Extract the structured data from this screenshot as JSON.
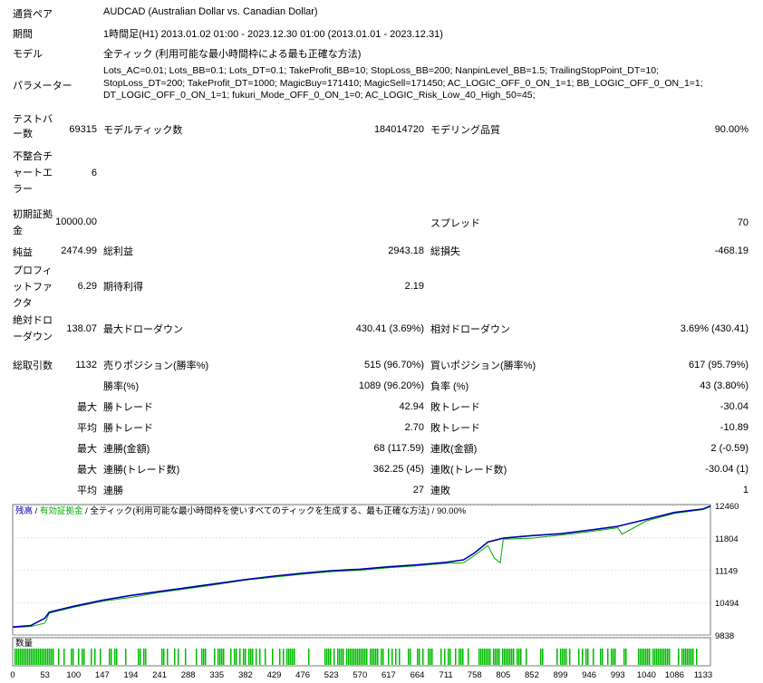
{
  "header": {
    "currency_pair_label": "通貨ペア",
    "currency_pair_value": "AUDCAD (Australian Dollar vs. Canadian Dollar)",
    "period_label": "期間",
    "period_value": "1時間足(H1) 2013.01.02 01:00 - 2023.12.30 01:00 (2013.01.01 - 2023.12.31)",
    "model_label": "モデル",
    "model_value": "全ティック (利用可能な最小時間枠による最も正確な方法)",
    "parameters_label": "パラメーター",
    "parameters_value": "Lots_AC=0.01; Lots_BB=0.1; Lots_DT=0.1; TakeProfit_BB=10; StopLoss_BB=200; NanpinLevel_BB=1.5; TrailingStopPoint_DT=10; StopLoss_DT=200; TakeProfit_DT=1000; MagicBuy=171410; MagicSell=171450; AC_LOGIC_OFF_0_ON_1=1; BB_LOGIC_OFF_0_ON_1=1; DT_LOGIC_OFF_0_ON_1=1; fukuri_Mode_OFF_0_ON_1=0; AC_LOGIC_Risk_Low_40_High_50=45;"
  },
  "stats": {
    "bars_label": "テストバー数",
    "bars_value": "69315",
    "model_ticks_label": "モデルティック数",
    "model_ticks_value": "184014720",
    "model_quality_label": "モデリング品質",
    "model_quality_value": "90.00%",
    "mismatch_label": "不整合チャートエラー",
    "mismatch_value": "6",
    "initial_deposit_label": "初期証拠金",
    "initial_deposit_value": "10000.00",
    "spread_label": "スプレッド",
    "spread_value": "70",
    "net_profit_label": "純益",
    "net_profit_value": "2474.99",
    "gross_profit_label": "総利益",
    "gross_profit_value": "2943.18",
    "gross_loss_label": "総損失",
    "gross_loss_value": "-468.19",
    "profit_factor_label": "プロフィットファクタ",
    "profit_factor_value": "6.29",
    "expected_payoff_label": "期待利得",
    "expected_payoff_value": "2.19",
    "abs_drawdown_label": "絶対ドローダウン",
    "abs_drawdown_value": "138.07",
    "max_drawdown_label": "最大ドローダウン",
    "max_drawdown_value": "430.41 (3.69%)",
    "rel_drawdown_label": "相対ドローダウン",
    "rel_drawdown_value": "3.69% (430.41)",
    "total_trades_label": "総取引数",
    "total_trades_value": "1132",
    "short_positions_label": "売りポジション(勝率%)",
    "short_positions_value": "515 (96.70%)",
    "long_positions_label": "買いポジション(勝率%)",
    "long_positions_value": "617 (95.79%)",
    "win_rate_label": "勝率(%)",
    "win_rate_value": "1089 (96.20%)",
    "loss_rate_label": "負率 (%)",
    "loss_rate_value": "43 (3.80%)",
    "max_label": "最大",
    "avg_label": "平均",
    "largest_win_label": "勝トレード",
    "largest_win_value": "42.94",
    "largest_loss_label": "敗トレード",
    "largest_loss_value": "-30.04",
    "avg_win_label": "勝トレード",
    "avg_win_value": "2.70",
    "avg_loss_label": "敗トレード",
    "avg_loss_value": "-10.89",
    "max_consec_wins_money_label": "連勝(金額)",
    "max_consec_wins_money_value": "68 (117.59)",
    "max_consec_losses_money_label": "連敗(金額)",
    "max_consec_losses_money_value": "2 (-0.59)",
    "max_consec_wins_trades_label": "連勝(トレード数)",
    "max_consec_wins_trades_value": "362.25 (45)",
    "max_consec_losses_trades_label": "連敗(トレード数)",
    "max_consec_losses_trades_value": "-30.04 (1)",
    "avg_consec_wins_label": "連勝",
    "avg_consec_wins_value": "27",
    "avg_consec_losses_label": "連敗",
    "avg_consec_losses_value": "1"
  },
  "chart_legend": {
    "balance": "残高",
    "sep1": " / ",
    "equity": "有効証拠金",
    "sep2": " / ",
    "model": "全ティック(利用可能な最小時間枠を使いすべてのティックを生成する、最も正確な方法)",
    "sep3": " / ",
    "quality": "90.00%",
    "volume_label": "数量"
  },
  "colors": {
    "balance": "#0000aa",
    "equity": "#00aa00",
    "volume": "#00bb00",
    "grid": "#c8c8c8"
  },
  "chart_data": {
    "type": "line",
    "y_ticks": [
      "12460",
      "11804",
      "11149",
      "10494",
      "9838"
    ],
    "x_ticks": [
      "0",
      "53",
      "100",
      "147",
      "194",
      "241",
      "288",
      "335",
      "382",
      "429",
      "476",
      "523",
      "570",
      "617",
      "664",
      "711",
      "758",
      "805",
      "852",
      "899",
      "946",
      "993",
      "1040",
      "1086",
      "1133"
    ],
    "ylim": [
      9838,
      12480
    ],
    "xlim": [
      0,
      1145
    ],
    "series": [
      {
        "x": [
          0,
          30,
          53,
          60,
          100,
          147,
          194,
          241,
          288,
          335,
          382,
          429,
          476,
          523,
          570,
          617,
          664,
          711,
          740,
          758,
          780,
          805,
          852,
          899,
          946,
          993,
          1040,
          1086,
          1133,
          1145
        ],
        "values": [
          10000,
          10030,
          10180,
          10300,
          10420,
          10540,
          10640,
          10720,
          10800,
          10880,
          10960,
          11030,
          11090,
          11140,
          11170,
          11220,
          11260,
          11310,
          11360,
          11500,
          11720,
          11800,
          11850,
          11890,
          11960,
          12040,
          12180,
          12320,
          12390,
          12450
        ]
      },
      {
        "x": [
          0,
          30,
          53,
          60,
          100,
          147,
          194,
          241,
          288,
          335,
          382,
          429,
          476,
          523,
          570,
          617,
          664,
          711,
          740,
          758,
          780,
          790,
          800,
          805,
          852,
          899,
          946,
          993,
          1000,
          1040,
          1086,
          1133,
          1145
        ],
        "values": [
          9990,
          10010,
          10080,
          10280,
          10400,
          10520,
          10600,
          10700,
          10780,
          10860,
          10950,
          11010,
          11070,
          11120,
          11150,
          11200,
          11240,
          11290,
          11300,
          11450,
          11650,
          11400,
          11300,
          11780,
          11800,
          11860,
          11930,
          12010,
          11880,
          12150,
          12300,
          12380,
          12440
        ]
      }
    ]
  }
}
